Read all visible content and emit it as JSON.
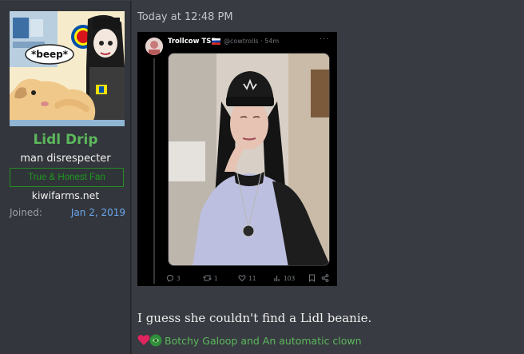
{
  "user": {
    "name": "Lidl Drip",
    "title": "man disrespecter",
    "banner": "True & Honest Fan",
    "site": "kiwifarms.net",
    "joined_label": "Joined:",
    "joined_date": "Jan 2, 2019",
    "avatar_speech": "*beep*",
    "avatar_logo_text": "Lidl"
  },
  "post": {
    "timestamp": "Today at 12:48 PM",
    "message": "I guess she couldn't find a Lidl beanie.",
    "reactions_text": "Botchy Galoop and An automatic clown"
  },
  "tweet": {
    "author": "Trollcow TSB",
    "handle": "@cowtrolls · 54m",
    "more": "···",
    "counts": {
      "replies": "3",
      "retweets": "1",
      "likes": "11",
      "views": "103"
    }
  },
  "colors": {
    "page_bg": "#2b2d31",
    "sidebar_bg": "#33363c",
    "main_bg": "#383b41",
    "username": "#5cb85c",
    "banner_border": "#258c25",
    "joined_date": "#6aa8f0",
    "reaction_text": "#5cb85c",
    "tweet_bg": "#000000"
  }
}
